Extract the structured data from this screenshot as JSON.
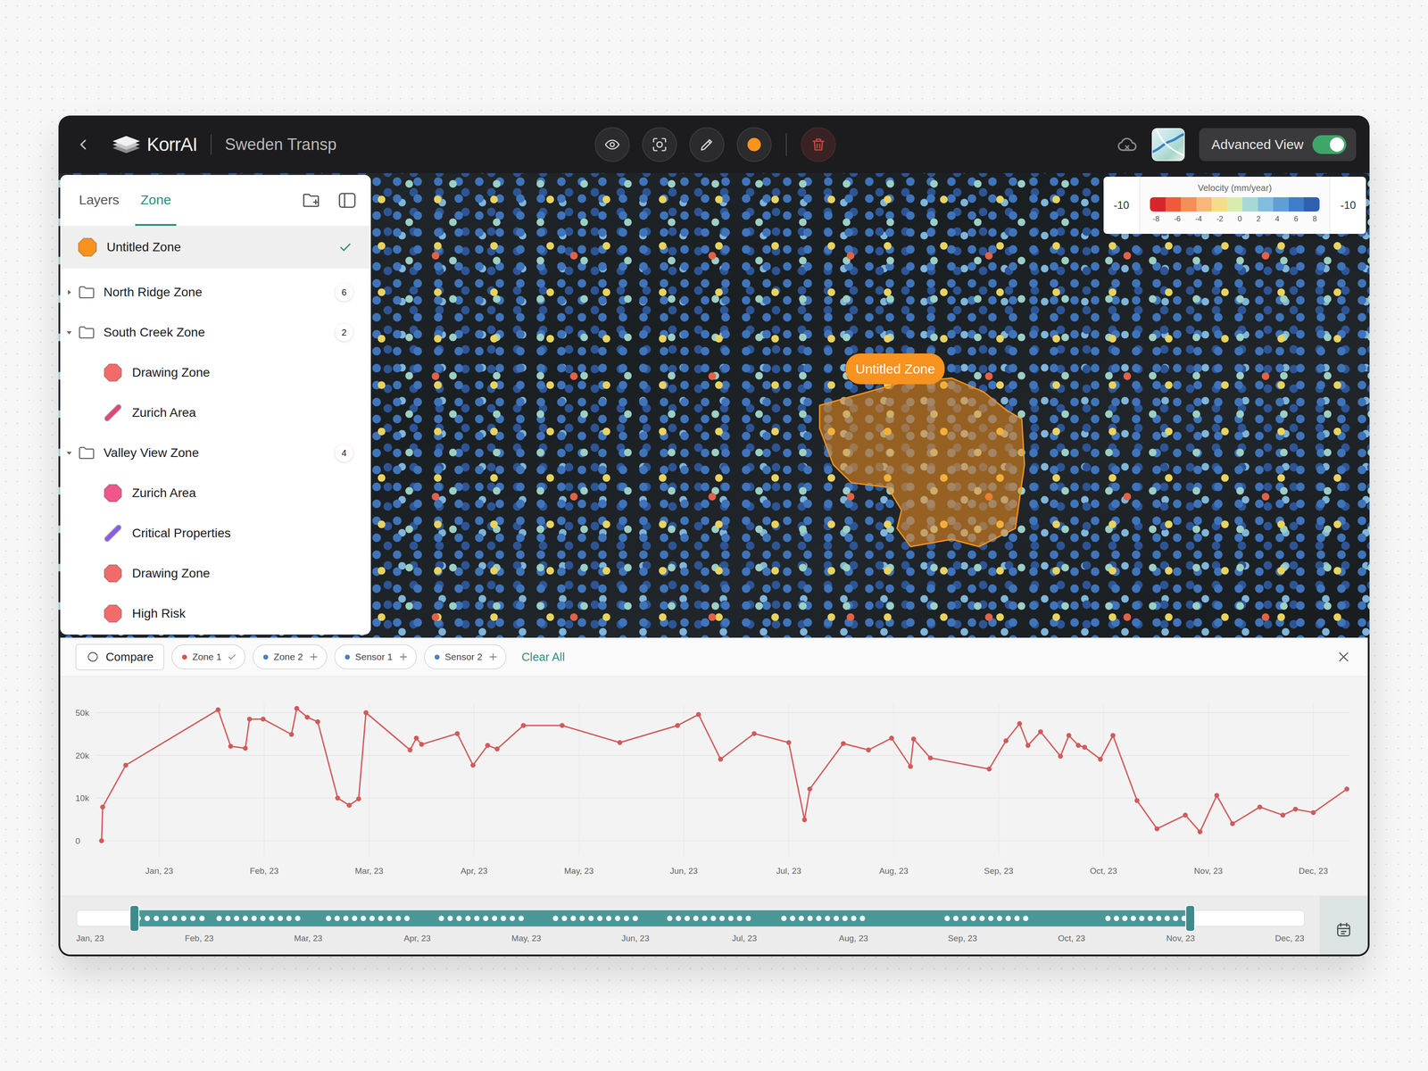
{
  "app": {
    "logo": "KorrAI",
    "project": "Sweden Transp",
    "advanced_view": {
      "label": "Advanced View",
      "on": true
    }
  },
  "toolbar": {
    "draw_color": "#F7931E"
  },
  "sidebar": {
    "tabs": [
      {
        "label": "Layers",
        "selected": false
      },
      {
        "label": "Zone",
        "selected": true
      }
    ],
    "items": [
      {
        "kind": "polygon",
        "label": "Untitled Zone",
        "color": "#F7931E",
        "selected": true
      },
      {
        "kind": "folder",
        "label": "North Ridge Zone",
        "count": "6",
        "expanded": false,
        "selected": false,
        "children": []
      },
      {
        "kind": "folder",
        "label": "South Creek Zone",
        "count": "2",
        "expanded": true,
        "selected": false,
        "children": [
          {
            "kind": "polygon",
            "label": "Drawing Zone",
            "color": "#F26B6B",
            "selected": false
          },
          {
            "kind": "line",
            "label": "Zurich Area",
            "color": "#E2457A",
            "selected": false
          }
        ]
      },
      {
        "kind": "folder",
        "label": "Valley View Zone",
        "count": "4",
        "expanded": true,
        "selected": false,
        "children": [
          {
            "kind": "polygon",
            "label": "Zurich Area",
            "color": "#F0568C",
            "selected": false
          },
          {
            "kind": "line",
            "label": "Critical Properties",
            "color": "#8A5CE6",
            "selected": false
          },
          {
            "kind": "polygon",
            "label": "Drawing Zone",
            "color": "#F26B6B",
            "selected": false
          },
          {
            "kind": "polygon",
            "label": "High Risk",
            "color": "#F26B6B",
            "selected": false
          }
        ]
      }
    ]
  },
  "map": {
    "zone": {
      "label": "Untitled Zone",
      "color": "#F7931E"
    }
  },
  "legend": {
    "title": "Velocity (mm/year)",
    "min": "-10",
    "max": "-10",
    "ticks": [
      "-8",
      "-6",
      "-4",
      "-2",
      "0",
      "2",
      "4",
      "6",
      "8"
    ],
    "colors": [
      "#D7262B",
      "#EF5A3C",
      "#F58E5A",
      "#F7B77A",
      "#F6DC8A",
      "#D8ECB0",
      "#A8D8D6",
      "#82BDE0",
      "#5F9FD6",
      "#3F7DC8",
      "#2F60B0"
    ]
  },
  "compare": {
    "button": "Compare",
    "clear": "Clear All",
    "chips": [
      {
        "label": "Zone 1",
        "color": "#D9534F",
        "added": true
      },
      {
        "label": "Zone 2",
        "color": "#4A7FC1",
        "added": false
      },
      {
        "label": "Sensor 1",
        "color": "#4A7FC1",
        "added": false
      },
      {
        "label": "Sensor 2",
        "color": "#4A7FC1",
        "added": false
      }
    ]
  },
  "chart": {
    "y_ticks": [
      "50k",
      "20k",
      "10k",
      "0"
    ],
    "y_tick_values": [
      50000,
      20000,
      10000,
      0
    ],
    "x_ticks": [
      "Jan, 23",
      "Feb, 23",
      "Mar, 23",
      "Apr, 23",
      "May, 23",
      "Jun, 23",
      "Jul, 23",
      "Aug, 23",
      "Sep, 23",
      "Oct, 23",
      "Nov, 23",
      "Dec, 23"
    ],
    "series": [
      {
        "color": "#D35A5A",
        "points": [
          {
            "t": -0.55,
            "v": 0
          },
          {
            "t": -0.54,
            "v": 7900
          },
          {
            "t": -0.32,
            "v": 17700
          },
          {
            "t": 0.56,
            "v": 52000
          },
          {
            "t": 0.68,
            "v": 26400
          },
          {
            "t": 0.82,
            "v": 25000
          },
          {
            "t": 0.86,
            "v": 45500
          },
          {
            "t": 0.99,
            "v": 45500
          },
          {
            "t": 1.26,
            "v": 34700
          },
          {
            "t": 1.31,
            "v": 53000
          },
          {
            "t": 1.41,
            "v": 46800
          },
          {
            "t": 1.51,
            "v": 43600
          },
          {
            "t": 1.7,
            "v": 10000
          },
          {
            "t": 1.81,
            "v": 8300
          },
          {
            "t": 1.9,
            "v": 9800
          },
          {
            "t": 1.97,
            "v": 50000
          },
          {
            "t": 2.39,
            "v": 23800
          },
          {
            "t": 2.45,
            "v": 32100
          },
          {
            "t": 2.5,
            "v": 27700
          },
          {
            "t": 2.84,
            "v": 35300
          },
          {
            "t": 2.99,
            "v": 17700
          },
          {
            "t": 3.13,
            "v": 27000
          },
          {
            "t": 3.22,
            "v": 24500
          },
          {
            "t": 3.47,
            "v": 41000
          },
          {
            "t": 3.84,
            "v": 41000
          },
          {
            "t": 4.39,
            "v": 29000
          },
          {
            "t": 4.94,
            "v": 41000
          },
          {
            "t": 5.14,
            "v": 48700
          },
          {
            "t": 5.35,
            "v": 19100
          },
          {
            "t": 5.67,
            "v": 35300
          },
          {
            "t": 6.0,
            "v": 29000
          },
          {
            "t": 6.15,
            "v": 4900
          },
          {
            "t": 6.2,
            "v": 12100
          },
          {
            "t": 6.52,
            "v": 28300
          },
          {
            "t": 6.76,
            "v": 23800
          },
          {
            "t": 6.98,
            "v": 32100
          },
          {
            "t": 7.16,
            "v": 17400
          },
          {
            "t": 7.19,
            "v": 31500
          },
          {
            "t": 7.35,
            "v": 19400
          },
          {
            "t": 7.91,
            "v": 16800
          },
          {
            "t": 8.07,
            "v": 30200
          },
          {
            "t": 8.2,
            "v": 42300
          },
          {
            "t": 8.28,
            "v": 27000
          },
          {
            "t": 8.4,
            "v": 36600
          },
          {
            "t": 8.59,
            "v": 19800
          },
          {
            "t": 8.67,
            "v": 34000
          },
          {
            "t": 8.76,
            "v": 27000
          },
          {
            "t": 8.82,
            "v": 25700
          },
          {
            "t": 8.97,
            "v": 19100
          },
          {
            "t": 9.09,
            "v": 34000
          },
          {
            "t": 9.32,
            "v": 9400
          },
          {
            "t": 9.51,
            "v": 2800
          },
          {
            "t": 9.78,
            "v": 6000
          },
          {
            "t": 9.92,
            "v": 2100
          },
          {
            "t": 10.08,
            "v": 10600
          },
          {
            "t": 10.23,
            "v": 4000
          },
          {
            "t": 10.49,
            "v": 7900
          },
          {
            "t": 10.71,
            "v": 6000
          },
          {
            "t": 10.83,
            "v": 7400
          },
          {
            "t": 11.0,
            "v": 6600
          },
          {
            "t": 11.32,
            "v": 12100
          }
        ]
      }
    ]
  },
  "timeline": {
    "labels": [
      "Jan, 23",
      "Feb, 23",
      "Mar, 23",
      "Apr, 23",
      "May, 23",
      "Jun, 23",
      "Jul, 23",
      "Aug, 23",
      "Sep, 23",
      "Oct, 23",
      "Nov, 23",
      "Dec, 23"
    ],
    "range": {
      "start": 0.047,
      "end": 0.907
    },
    "groups": [
      {
        "start": 0.05,
        "end": 0.102,
        "count": 8
      },
      {
        "start": 0.116,
        "end": 0.18,
        "count": 10
      },
      {
        "start": 0.205,
        "end": 0.269,
        "count": 10
      },
      {
        "start": 0.297,
        "end": 0.362,
        "count": 10
      },
      {
        "start": 0.39,
        "end": 0.455,
        "count": 10
      },
      {
        "start": 0.483,
        "end": 0.547,
        "count": 10
      },
      {
        "start": 0.576,
        "end": 0.64,
        "count": 10
      },
      {
        "start": 0.709,
        "end": 0.773,
        "count": 10
      },
      {
        "start": 0.84,
        "end": 0.902,
        "count": 10
      }
    ]
  }
}
